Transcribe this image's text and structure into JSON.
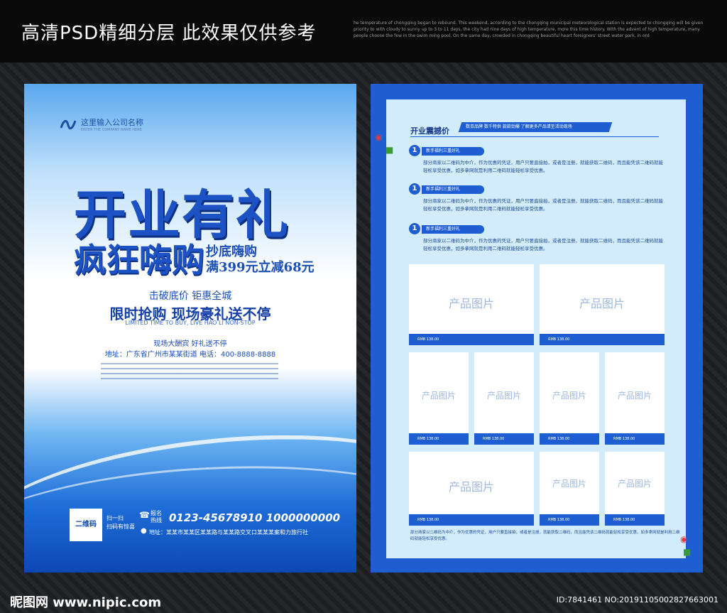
{
  "header": {
    "title": "高清PSD精细分层 此效果仅供参考",
    "blurb": "he temperature of chongqing began to rebound. This weekend, according to the chongqing municipal meteorological station is expected to chongqing will be given priority to with cloudy to sunny up to 3 to 11 days, the city had nine days of high temperature, more this time history. With the advent of high temperature, many people choose the few in the swim ming pool. On the same day, crowded in chongqing beautiful heart foreigners' street water park, in ord"
  },
  "left_poster": {
    "company_cn": "这里输入公司名称",
    "company_en": "ENTER THE COMPANY NAME HERE",
    "headline": "开业有礼",
    "subhead": "疯狂嗨购",
    "sub_right_1": "抄底嗨购",
    "sub_right_2": "满399元立减68元",
    "tag_1": "击破底价 钜惠全城",
    "tag_2": "限时抢购 现场豪礼送不停",
    "tag_3": "LIMITED TIME TO BUY, LIVE HAO LI NON-STOP",
    "tag_4": "现场大酬宾 好礼送不停",
    "tag_5": "地址：广东省广州市某某街道  电话：400-8888-8888",
    "qr_label": "二维码",
    "scan_1": "扫一扫",
    "scan_2": "扫码有惊喜",
    "hotline_1": "报名",
    "hotline_2": "热线",
    "phone": "0123-45678910   1000000000",
    "address": "地址：某某市某某区某某路与某某路交叉口某某某案和力旅行社"
  },
  "right_poster": {
    "section_title": "开业震撼价",
    "section_bar": "数百品牌  数千特供  款款劲爆  了解更多产品请至活动现场",
    "items": [
      {
        "num": "1",
        "pill": "新手福利三重好礼",
        "desc": "部分商家以二维码为中介，作为优惠的凭证，用户只要直接拍，或者是注册，就能获取二维码，而且能凭该二维码就能轻松享受优惠，如多拿网就是利用二维码就能轻松享受优惠。"
      },
      {
        "num": "1",
        "pill": "新手福利三重好礼",
        "desc": "部分商家以二维码为中介，作为优惠的凭证，用户只要直接拍，或者是注册，就能获取二维码，而且能凭该二维码就能轻松享受优惠，如多拿网就是利用二维码就能轻松享受优惠。"
      },
      {
        "num": "1",
        "pill": "新手福利三重好礼",
        "desc": "部分商家以二维码为中介，作为优惠的凭证，用户只要直接拍，或者是注册，就能获取二维码，而且能凭该二维码就能轻松享受优惠，如多拿网就是利用二维码就能轻松享受优惠。"
      }
    ],
    "product_label": "产品图片",
    "price_label": "RMB 138.00",
    "footer": "部分商家以二维码为中介，作为优惠的凭证，用户只要直接拍，或者是注册，就能获取二维码，而且能凭该二维码就能轻松享受优惠，如多拿网就是利用二维码就能轻松享受优惠。"
  },
  "watermark": {
    "logo": "昵图网 www.nipic.com",
    "id": "ID:7841461 NO:20191105002827663001"
  }
}
